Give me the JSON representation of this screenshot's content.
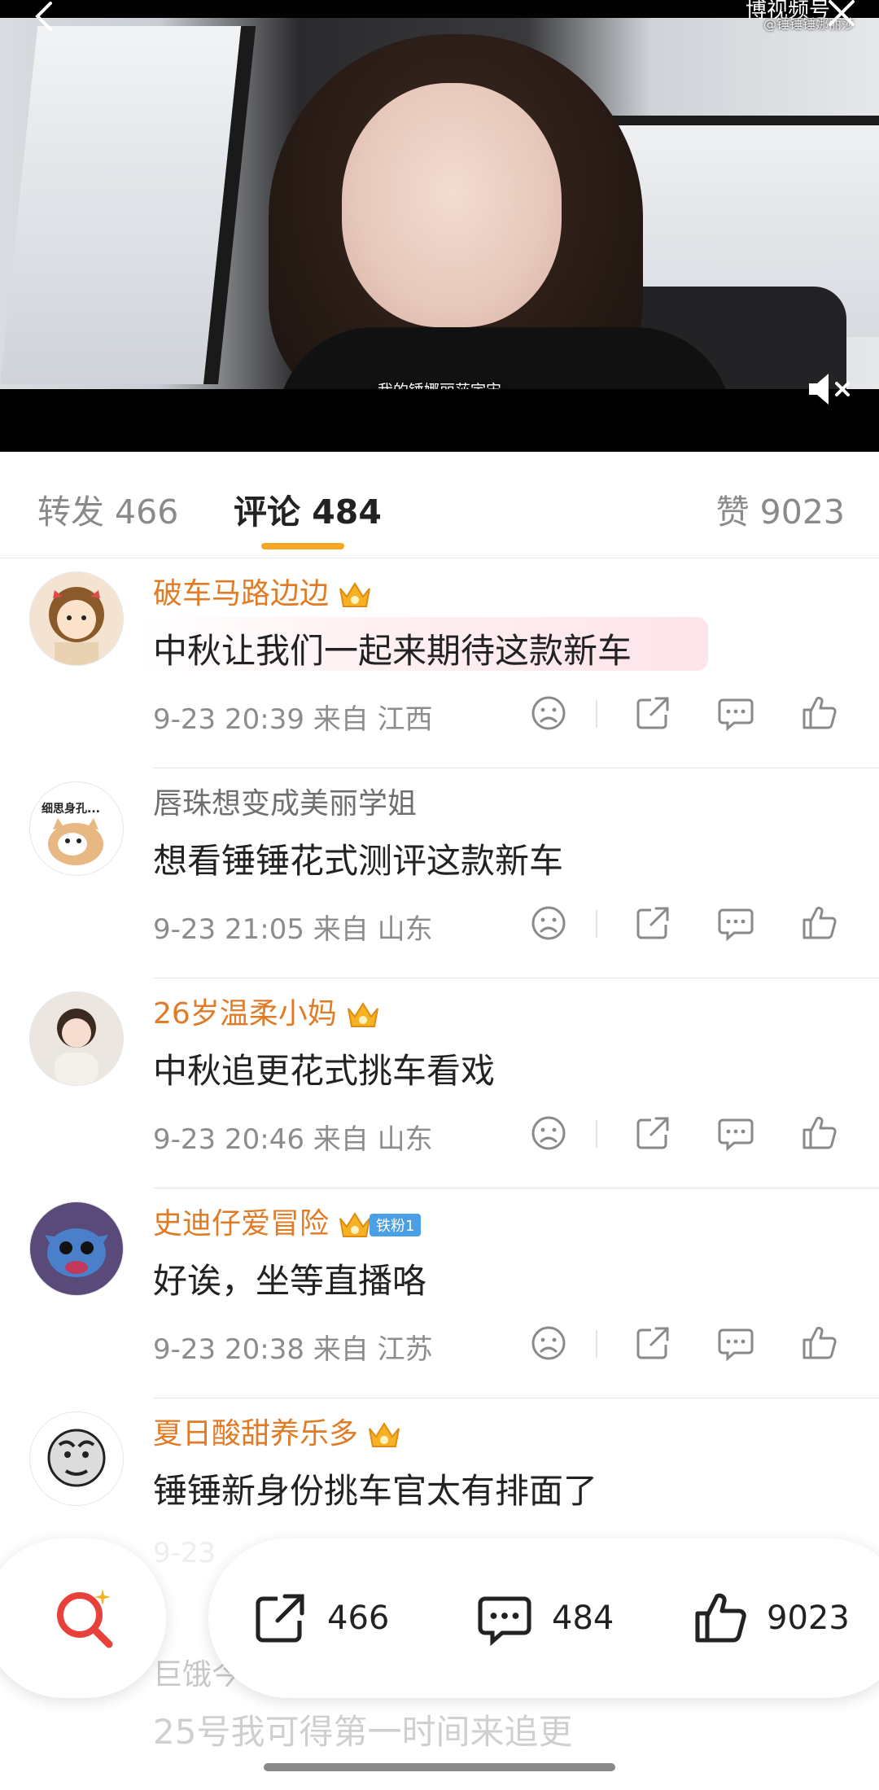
{
  "video": {
    "subtitle": "我的锤娜丽莎宇宙",
    "watermark": "@锤锤锤娜丽莎",
    "top_label": "博视频号"
  },
  "tabs": [
    {
      "label": "转发 466"
    },
    {
      "label": "评论 484"
    },
    {
      "label": "赞 9023"
    }
  ],
  "comments": [
    {
      "name": "破车马路边边",
      "text": "中秋让我们一起来期待这款新车",
      "time": "9-23 20:39",
      "from": "来自",
      "location": "江西"
    },
    {
      "name": "唇珠想变成美丽学姐",
      "avatar_caption": "细思身孔...",
      "text": "想看锤锤花式测评这款新车",
      "time": "9-23 21:05",
      "from": "来自",
      "location": "山东"
    },
    {
      "name": "26岁温柔小妈",
      "text": "中秋追更花式挑车看戏",
      "time": "9-23 20:46",
      "from": "来自",
      "location": "山东"
    },
    {
      "name": "史迪仔爱冒险",
      "fan_badge": "铁粉1",
      "text": "好诶，坐等直播咯",
      "time": "9-23 20:38",
      "from": "来自",
      "location": "江苏"
    },
    {
      "name": "夏日酸甜养乐多",
      "text": "锤锤新身份挑车官太有排面了",
      "time": "9-23"
    }
  ],
  "ghost_comment": {
    "name": "巨饿今",
    "text": "25号我可得第一时间来追更"
  },
  "bottom_bar": {
    "repost_count": "466",
    "comment_count": "484",
    "like_count": "9023"
  },
  "colors": {
    "accent": "#f5a623",
    "username": "#e07b26",
    "fan_badge": "#4a9fe5",
    "search_icon": "#e8413c"
  }
}
